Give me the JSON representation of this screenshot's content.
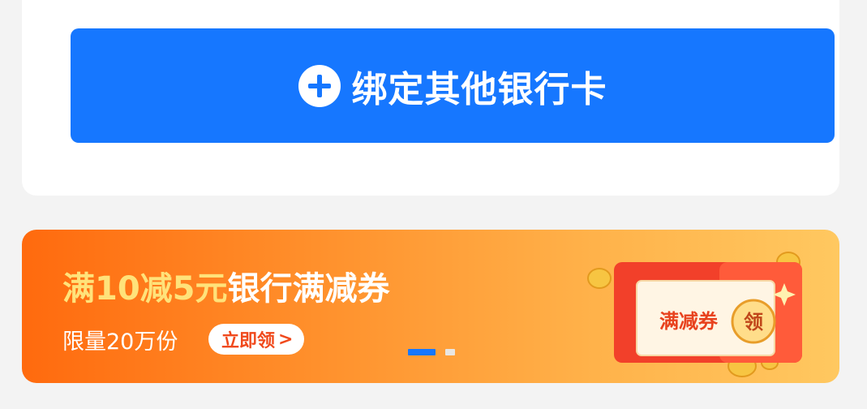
{
  "bind_card": {
    "label": "绑定其他银行卡",
    "icon": "plus-circle-icon",
    "accent": "#1677ff"
  },
  "banner": {
    "title_highlight": "满10减5元",
    "title_rest": "银行满减券",
    "subtitle": "限量20万份",
    "cta_label": "立即领",
    "cta_chevron": ">",
    "coupon_text": "满减券",
    "coupon_badge": "领",
    "carousel": {
      "total": 2,
      "active": 1
    },
    "colors": {
      "start": "#ff6a0e",
      "end": "#ffc860",
      "highlight": "#ffe27a",
      "cta_text": "#f0491c"
    }
  }
}
